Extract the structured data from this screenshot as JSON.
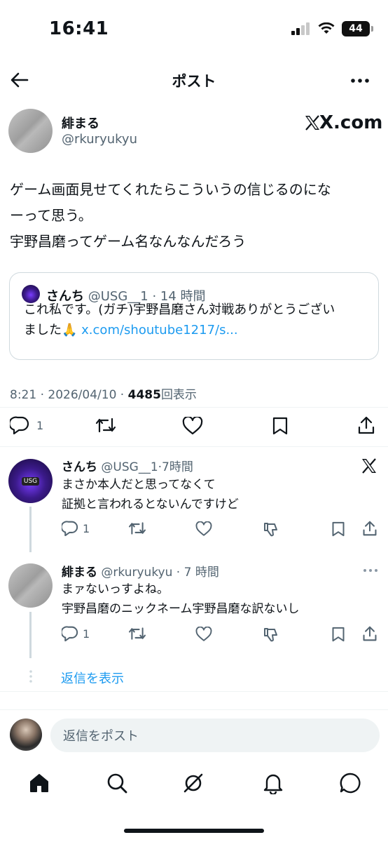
{
  "status_bar": {
    "time": "16:41",
    "battery": "44"
  },
  "header": {
    "title": "ポスト"
  },
  "post": {
    "author_name": "緋まる",
    "author_handle": "@rkuryukyu",
    "source_logo": "X.com",
    "text_lines": [
      "ゲーム画面見せてくれたらこういうの信じるのにな",
      "ーって思う。",
      "宇野昌磨ってゲーム名なんなんだろう"
    ],
    "quote": {
      "author_name": "さんち",
      "author_handle": "@USG__1",
      "time": "14 時間",
      "line1": "これ私です。(ガチ)宇野昌磨さん対戦ありがとうござい",
      "line2_prefix": "ました",
      "emoji": "🙏",
      "link": "x.com/shoutube1217/s..."
    },
    "meta": {
      "time": "8:21",
      "date": "2026/04/10",
      "views_count": "4485",
      "views_label": "回表示"
    },
    "actions": {
      "reply_count": "1"
    }
  },
  "replies": [
    {
      "author_name": "さんち",
      "author_handle": "@USG__1",
      "time": "7時間",
      "lines": [
        "まさか本人だと思ってなくて",
        "証拠と言われるとないんですけど"
      ],
      "reply_count": "1",
      "avatar_text": "USG"
    },
    {
      "author_name": "緋まる",
      "author_handle": "@rkuryukyu",
      "time": "7 時間",
      "lines": [
        "まァないっすよね。",
        "宇野昌磨のニックネーム宇野昌磨な訳ないし"
      ],
      "reply_count": "1"
    }
  ],
  "show_replies": "返信を表示",
  "compose": {
    "placeholder": "返信をポスト"
  },
  "colors": {
    "link": "#1d9bf0",
    "secondary_text": "#536471",
    "border": "#cfd9de"
  }
}
